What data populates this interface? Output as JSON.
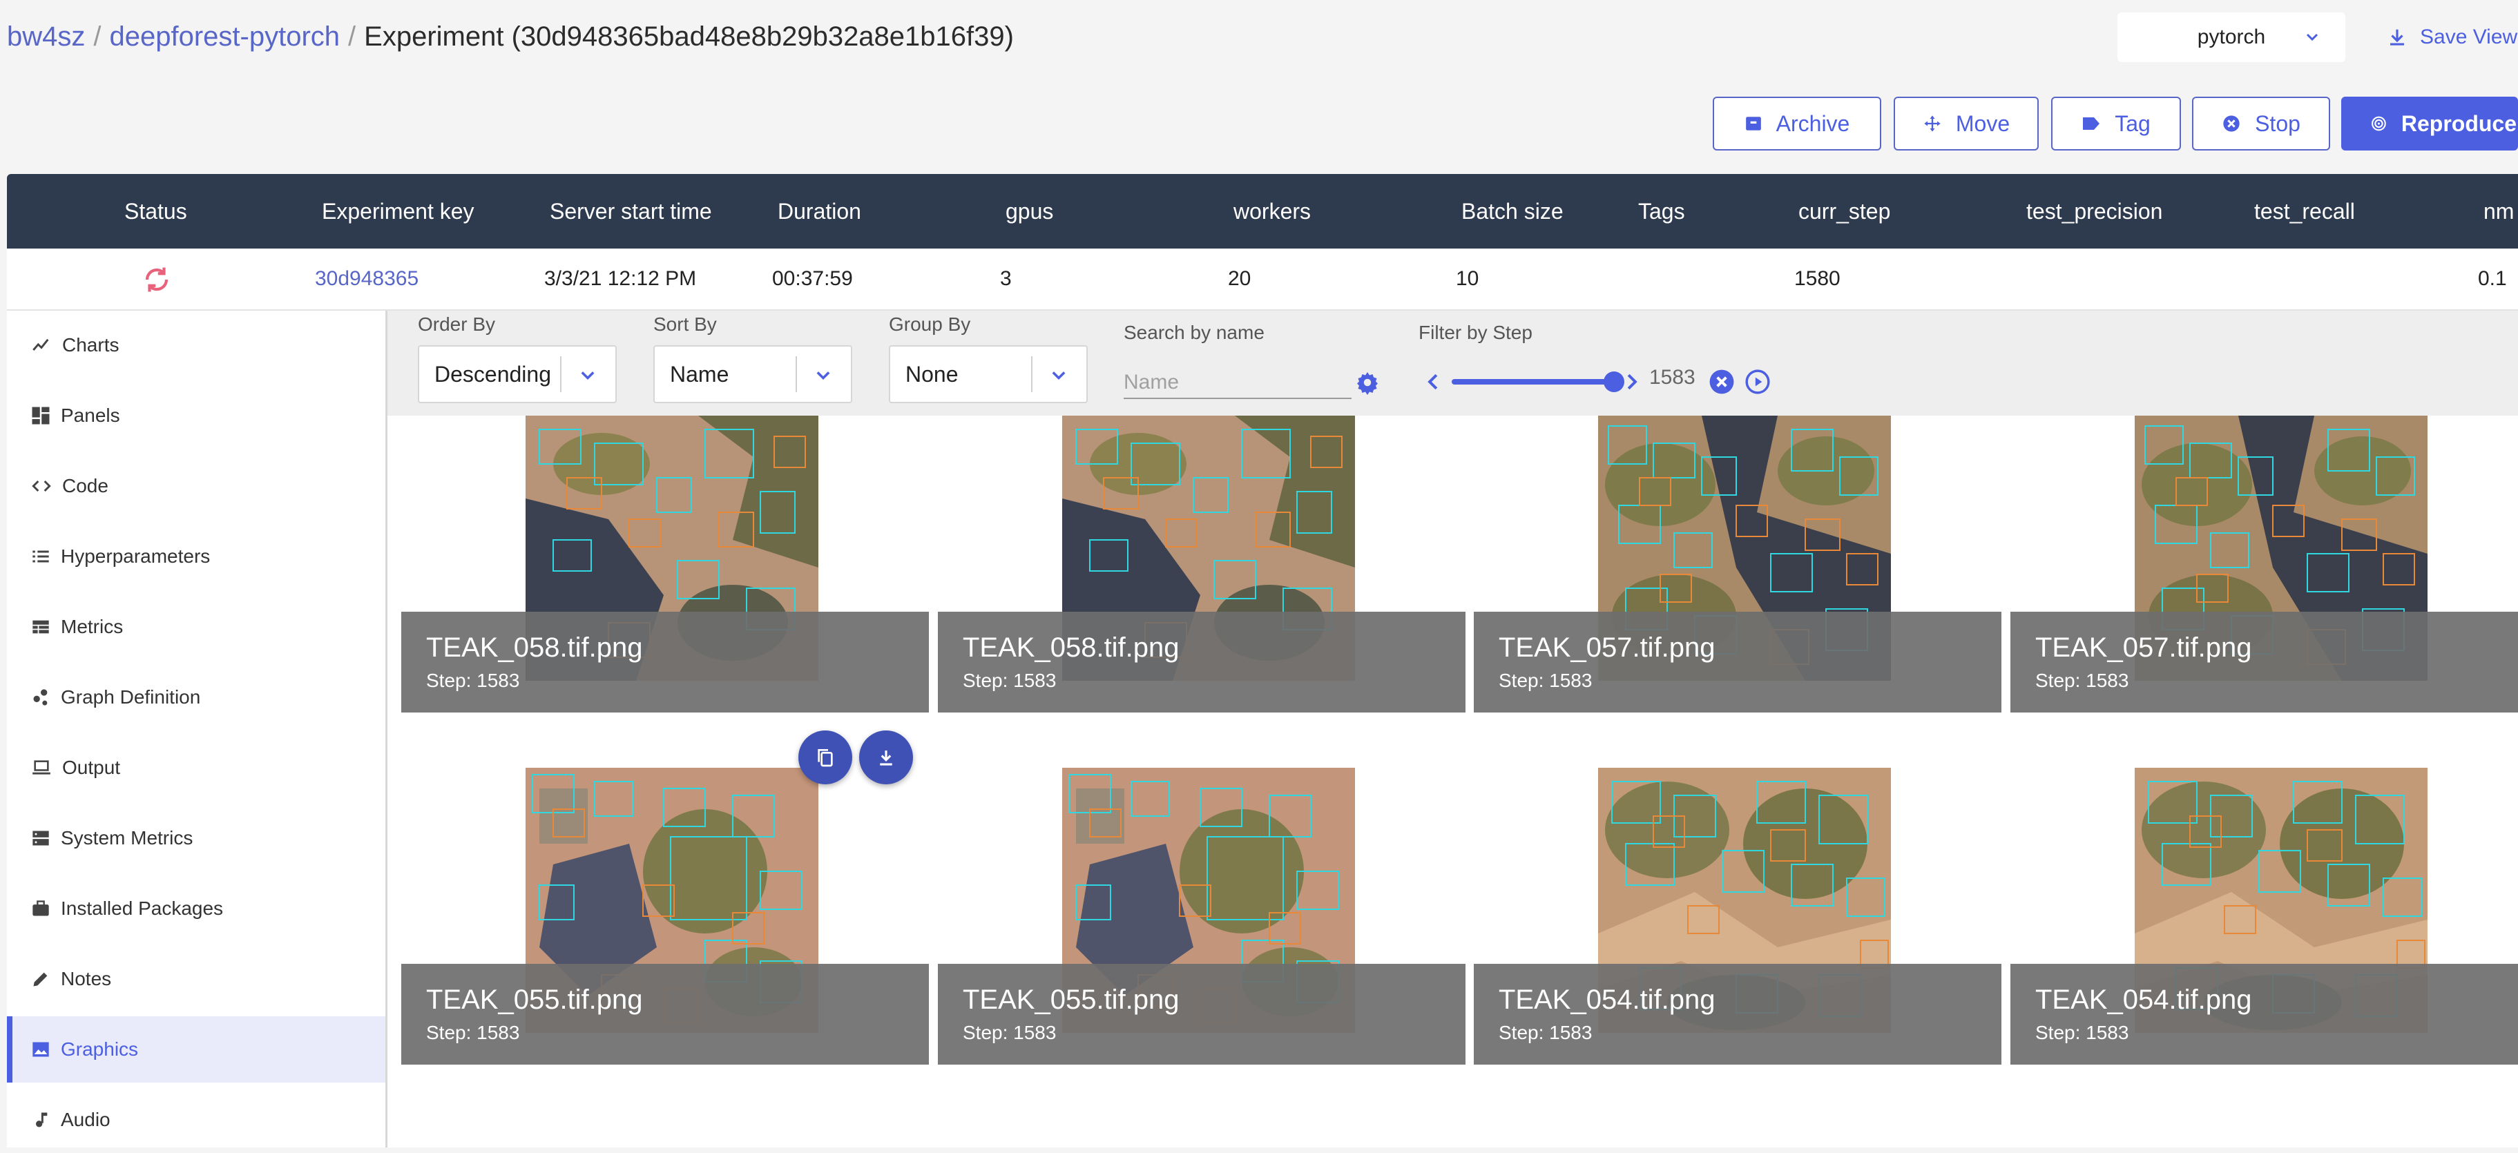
{
  "breadcrumb": {
    "workspace": "bw4sz",
    "sep1": "/",
    "project": "deepforest-pytorch",
    "sep2": "/",
    "experiment": "Experiment (30d948365bad48e8b29b32a8e1b16f39)"
  },
  "project_selector": {
    "value": "pytorch",
    "icon": "chevron-down-icon"
  },
  "save_view": {
    "label": "Save View",
    "icon": "download-icon"
  },
  "actions": [
    {
      "label": "Archive",
      "icon": "archive-icon"
    },
    {
      "label": "Move",
      "icon": "move-icon"
    },
    {
      "label": "Tag",
      "icon": "tag-icon"
    },
    {
      "label": "Stop",
      "icon": "stop-icon"
    },
    {
      "label": "Reproduce",
      "icon": "fingerprint-icon"
    }
  ],
  "table": {
    "headers": [
      "Status",
      "Experiment key",
      "Server start time",
      "Duration",
      "gpus",
      "workers",
      "Batch size",
      "Tags",
      "curr_step",
      "test_precision",
      "test_recall",
      "nm"
    ],
    "row": {
      "status_icon": "running-refresh-icon",
      "experiment_key": "30d948365",
      "server_start_time": "3/3/21 12:12 PM",
      "duration": "00:37:59",
      "gpus": "3",
      "workers": "20",
      "batch_size": "10",
      "tags": "",
      "curr_step": "1580",
      "test_precision": "",
      "test_recall": "",
      "nm": "0.1"
    }
  },
  "sidebar": {
    "items": [
      {
        "label": "Charts",
        "icon": "line-chart-icon",
        "active": false
      },
      {
        "label": "Panels",
        "icon": "dashboard-icon",
        "active": false
      },
      {
        "label": "Code",
        "icon": "code-icon",
        "active": false
      },
      {
        "label": "Hyperparameters",
        "icon": "list-icon",
        "active": false
      },
      {
        "label": "Metrics",
        "icon": "table-icon",
        "active": false
      },
      {
        "label": "Graph Definition",
        "icon": "graph-icon",
        "active": false
      },
      {
        "label": "Output",
        "icon": "laptop-icon",
        "active": false
      },
      {
        "label": "System Metrics",
        "icon": "server-icon",
        "active": false
      },
      {
        "label": "Installed Packages",
        "icon": "briefcase-icon",
        "active": false
      },
      {
        "label": "Notes",
        "icon": "pencil-icon",
        "active": false
      },
      {
        "label": "Graphics",
        "icon": "image-icon",
        "active": true
      },
      {
        "label": "Audio",
        "icon": "music-note-icon",
        "active": false
      }
    ]
  },
  "filters": {
    "order_by": {
      "label": "Order By",
      "value": "Descending"
    },
    "sort_by": {
      "label": "Sort By",
      "value": "Name"
    },
    "group_by": {
      "label": "Group By",
      "value": "None"
    },
    "search": {
      "label": "Search by name",
      "placeholder": "Name",
      "value": ""
    },
    "step": {
      "label": "Filter by Step",
      "value": "1583",
      "position_fraction": 1.0
    }
  },
  "images": [
    {
      "name": "TEAK_058.tif.png",
      "step": "Step: 1583"
    },
    {
      "name": "TEAK_058.tif.png",
      "step": "Step: 1583"
    },
    {
      "name": "TEAK_057.tif.png",
      "step": "Step: 1583"
    },
    {
      "name": "TEAK_057.tif.png",
      "step": "Step: 1583"
    },
    {
      "name": "TEAK_055.tif.png",
      "step": "Step: 1583"
    },
    {
      "name": "TEAK_055.tif.png",
      "step": "Step: 1583"
    },
    {
      "name": "TEAK_054.tif.png",
      "step": "Step: 1583"
    },
    {
      "name": "TEAK_054.tif.png",
      "step": "Step: 1583"
    }
  ],
  "colors": {
    "accent": "#4b5fe0",
    "header_bg": "#2e3b4e",
    "running_status": "#e8627c",
    "bbox_cyan": "#2fd8e0",
    "bbox_orange": "#e8893a"
  }
}
